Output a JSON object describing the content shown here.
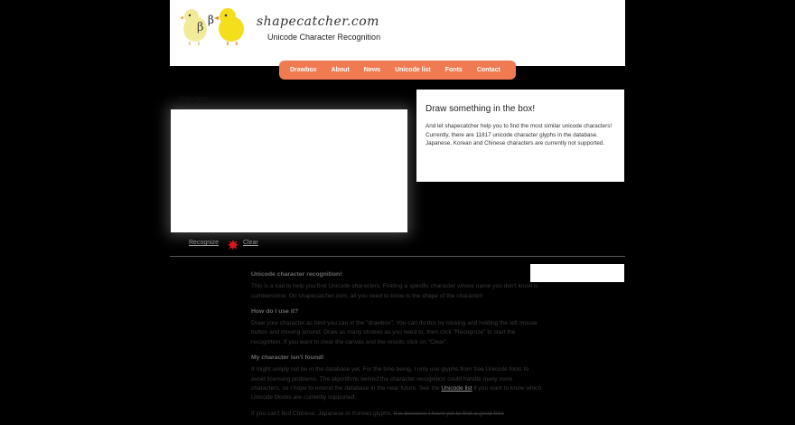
{
  "header": {
    "site_name": "shapecatcher.com",
    "subtitle": "Unicode Character Recognition",
    "logo_glyph_left": "β",
    "logo_glyph_right": "β"
  },
  "nav": {
    "items": [
      "Drawbox",
      "About",
      "News",
      "Unicode list",
      "Fonts",
      "Contact"
    ],
    "background": "#f07a52"
  },
  "drawbox": {
    "caption": "Draw here:",
    "recognize_label": "Recognize",
    "clear_label": "Clear",
    "clear_icon": "red-splat-icon"
  },
  "infobox": {
    "title": "Draw something in the box!",
    "line1": "And let shapecatcher help you to find the most similar unicode characters!",
    "line2": "Currently, there are 11817 unicode character glyphs in the database. Japanese, Korean and Chinese characters are currently not supported."
  },
  "content": {
    "heading1": "Unicode character recognition!",
    "para1": "This is a tool to help you find Unicode characters. Finding a specific character whose name you don't know is cumbersome. On shapecatcher.com, all you need to know is the shape of the character!",
    "heading2": "How do I use it?",
    "para2": "Draw your character as best you can in the \"drawbox\". You can do this by clicking and holding the left mouse button and moving around. Draw as many strokes as you need to, then click \"Recognize\" to start the recognition. If you want to clear the canvas and the results click on \"Clear\".",
    "heading3": "My character isn't found!",
    "para3_pre": "It might simply not be in the database yet. For the time being, I only use glyphs from free Unicode fonts to avoid licensing problems. The algorithms behind the character recognition could handle many more characters, so I hope to extend the database in the near future. See the",
    "para3_link": "Unicode list",
    "para3_post": "if you want to know which Unicode blocks are currently supported.",
    "para4_pre": "If you can't find Chinese, Japanese or Korean glyphs,",
    "para4_strike": "it is because I have yet to find a good free"
  }
}
